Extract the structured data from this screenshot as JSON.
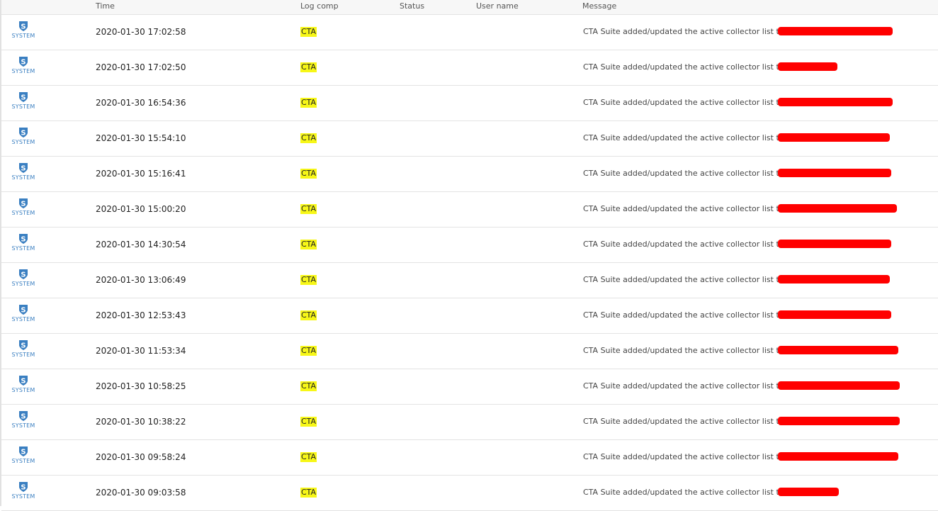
{
  "columns": {
    "time": "Time",
    "log_comp": "Log comp",
    "status": "Status",
    "user_name": "User name",
    "message": "Message"
  },
  "colors": {
    "highlight": "#f7f717",
    "app_icon": "#3a7fc1",
    "redaction": "#ff0000"
  },
  "rows": [
    {
      "app": "SYSTEM",
      "icon": "shield-s-icon",
      "time": "2020-01-30 17:02:58",
      "log_comp": "CTA",
      "status": "",
      "user": "",
      "message": "CTA Suite added/updated the active collector list to"
    },
    {
      "app": "SYSTEM",
      "icon": "shield-s-icon",
      "time": "2020-01-30 17:02:50",
      "log_comp": "CTA",
      "status": "",
      "user": "",
      "message": "CTA Suite added/updated the active collector list to"
    },
    {
      "app": "SYSTEM",
      "icon": "shield-s-icon",
      "time": "2020-01-30 16:54:36",
      "log_comp": "CTA",
      "status": "",
      "user": "",
      "message": "CTA Suite added/updated the active collector list to"
    },
    {
      "app": "SYSTEM",
      "icon": "shield-s-icon",
      "time": "2020-01-30 15:54:10",
      "log_comp": "CTA",
      "status": "",
      "user": "",
      "message": "CTA Suite added/updated the active collector list to"
    },
    {
      "app": "SYSTEM",
      "icon": "shield-s-icon",
      "time": "2020-01-30 15:16:41",
      "log_comp": "CTA",
      "status": "",
      "user": "",
      "message": "CTA Suite added/updated the active collector list to"
    },
    {
      "app": "SYSTEM",
      "icon": "shield-s-icon",
      "time": "2020-01-30 15:00:20",
      "log_comp": "CTA",
      "status": "",
      "user": "",
      "message": "CTA Suite added/updated the active collector list to"
    },
    {
      "app": "SYSTEM",
      "icon": "shield-s-icon",
      "time": "2020-01-30 14:30:54",
      "log_comp": "CTA",
      "status": "",
      "user": "",
      "message": "CTA Suite added/updated the active collector list to"
    },
    {
      "app": "SYSTEM",
      "icon": "shield-s-icon",
      "time": "2020-01-30 13:06:49",
      "log_comp": "CTA",
      "status": "",
      "user": "",
      "message": "CTA Suite added/updated the active collector list to"
    },
    {
      "app": "SYSTEM",
      "icon": "shield-s-icon",
      "time": "2020-01-30 12:53:43",
      "log_comp": "CTA",
      "status": "",
      "user": "",
      "message": "CTA Suite added/updated the active collector list to"
    },
    {
      "app": "SYSTEM",
      "icon": "shield-s-icon",
      "time": "2020-01-30 11:53:34",
      "log_comp": "CTA",
      "status": "",
      "user": "",
      "message": "CTA Suite added/updated the active collector list to"
    },
    {
      "app": "SYSTEM",
      "icon": "shield-s-icon",
      "time": "2020-01-30 10:58:25",
      "log_comp": "CTA",
      "status": "",
      "user": "",
      "message": "CTA Suite added/updated the active collector list to"
    },
    {
      "app": "SYSTEM",
      "icon": "shield-s-icon",
      "time": "2020-01-30 10:38:22",
      "log_comp": "CTA",
      "status": "",
      "user": "",
      "message": "CTA Suite added/updated the active collector list to"
    },
    {
      "app": "SYSTEM",
      "icon": "shield-s-icon",
      "time": "2020-01-30 09:58:24",
      "log_comp": "CTA",
      "status": "",
      "user": "",
      "message": "CTA Suite added/updated the active collector list to"
    },
    {
      "app": "SYSTEM",
      "icon": "shield-s-icon",
      "time": "2020-01-30 09:03:58",
      "log_comp": "CTA",
      "status": "",
      "user": "",
      "message": "CTA Suite added/updated the active collector list to"
    }
  ]
}
